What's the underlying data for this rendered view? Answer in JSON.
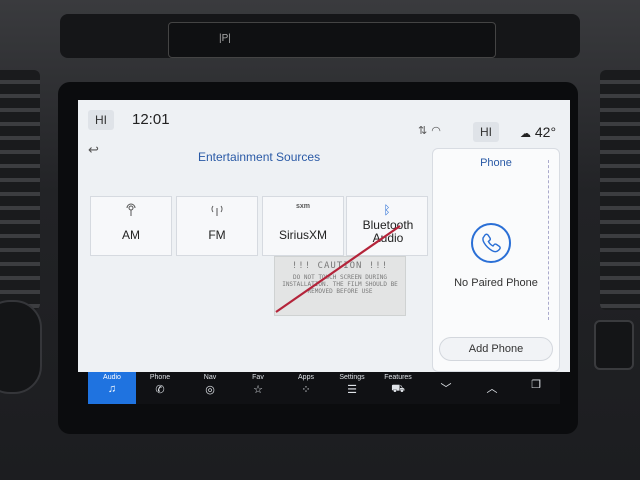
{
  "status": {
    "hi_left": "HI",
    "time": "12:01",
    "hi_right": "HI",
    "temperature": "42°"
  },
  "entertainment": {
    "title": "Entertainment Sources",
    "sources": [
      {
        "label": "AM",
        "icon": "antenna-icon"
      },
      {
        "label": "FM",
        "icon": "broadcast-icon"
      },
      {
        "label": "SiriusXM",
        "icon": "sxm-icon",
        "icon_text": "sxm"
      },
      {
        "label": "Bluetooth Audio",
        "icon": "bluetooth-icon"
      }
    ]
  },
  "caution_sticker": {
    "heading": "!!! CAUTION !!!",
    "body": "DO NOT TOUCH SCREEN DURING INSTALLATION. THE FILM SHOULD BE REMOVED BEFORE USE"
  },
  "phone": {
    "title": "Phone",
    "status": "No Paired Phone",
    "add_button": "Add Phone"
  },
  "hazard_label": "|P|",
  "nav": [
    {
      "label": "Audio",
      "icon": "music-note-icon",
      "active": true
    },
    {
      "label": "Phone",
      "icon": "phone-icon"
    },
    {
      "label": "Nav",
      "icon": "compass-icon"
    },
    {
      "label": "Fav",
      "icon": "star-icon"
    },
    {
      "label": "Apps",
      "icon": "apps-grid-icon"
    },
    {
      "label": "Settings",
      "icon": "sliders-icon"
    },
    {
      "label": "Features",
      "icon": "car-icon"
    },
    {
      "label": "",
      "icon": "chevron-down-icon"
    },
    {
      "label": "",
      "icon": "chevron-up-icon"
    },
    {
      "label": "",
      "icon": "copy-screens-icon"
    }
  ],
  "colors": {
    "accent": "#1f73e0",
    "title_blue": "#2a5aa6"
  }
}
